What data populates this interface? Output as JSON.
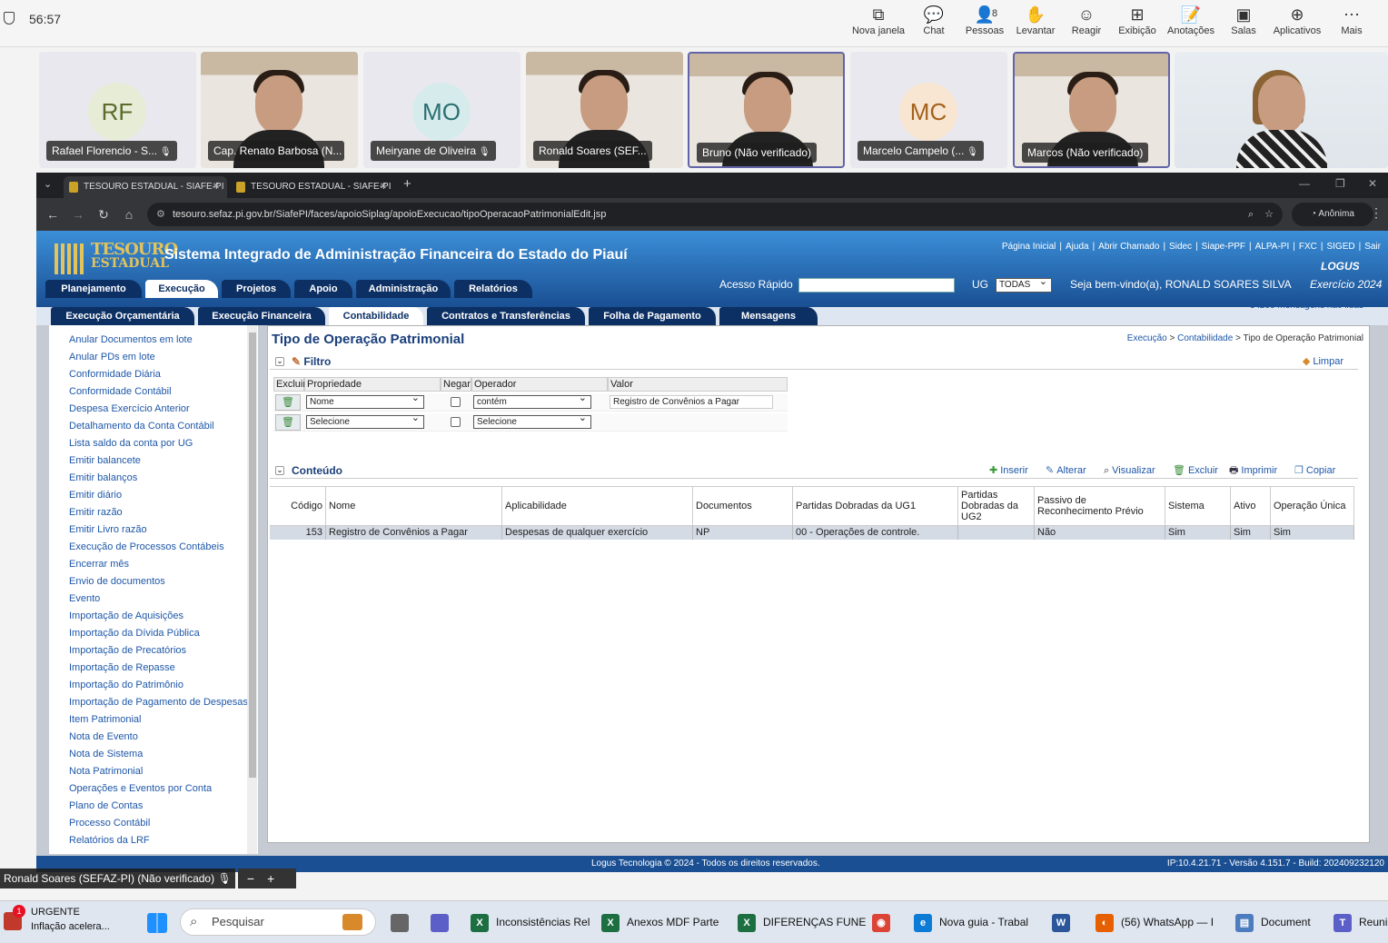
{
  "teams": {
    "time": "56:57",
    "buttons": [
      {
        "label": "Nova janela",
        "icon": "new-window-icon",
        "glyph": "⧉"
      },
      {
        "label": "Chat",
        "icon": "chat-icon",
        "glyph": "💬"
      },
      {
        "label": "Pessoas",
        "icon": "people-icon",
        "glyph": "👤",
        "badge": "8"
      },
      {
        "label": "Levantar",
        "icon": "raise-hand-icon",
        "glyph": "✋"
      },
      {
        "label": "Reagir",
        "icon": "react-icon",
        "glyph": "☺"
      },
      {
        "label": "Exibição",
        "icon": "view-icon",
        "glyph": "⊞"
      },
      {
        "label": "Anotações",
        "icon": "notes-icon",
        "glyph": "📝"
      },
      {
        "label": "Salas",
        "icon": "rooms-icon",
        "glyph": "▣"
      },
      {
        "label": "Aplicativos",
        "icon": "apps-icon",
        "glyph": "⊕"
      },
      {
        "label": "Mais",
        "icon": "more-icon",
        "glyph": "⋯"
      }
    ],
    "participants": [
      {
        "name": "Rafael Florencio - S...",
        "initials": "RF",
        "avatar_bg": "#e6ecd6",
        "avatar_fg": "#5a6b2c",
        "video": false
      },
      {
        "name": "Cap. Renato Barbosa (N...",
        "initials": "",
        "video": true
      },
      {
        "name": "Meiryane de Oliveira",
        "initials": "MO",
        "avatar_bg": "#d6ecec",
        "avatar_fg": "#2b6f72",
        "video": false
      },
      {
        "name": "Ronald Soares (SEF...",
        "initials": "",
        "video": true
      },
      {
        "name": "Bruno (Não verificado)",
        "initials": "",
        "video": true,
        "selected": true
      },
      {
        "name": "Marcelo Campelo (...",
        "initials": "MC",
        "avatar_bg": "#f8e6d2",
        "avatar_fg": "#a4621c",
        "video": false
      },
      {
        "name": "Marcos (Não verificado)",
        "initials": "",
        "video": true,
        "selected": true
      },
      {
        "name": "",
        "initials": "",
        "video": true
      }
    ],
    "self_tag": "Ronald Soares (SEFAZ-PI) (Não verificado)"
  },
  "browser": {
    "tabs": [
      "TESOURO ESTADUAL - SIAFE-PI",
      "TESOURO ESTADUAL - SIAFE-PI"
    ],
    "url": "tesouro.sefaz.pi.gov.br/SiafePI/faces/apoioSiplag/apoioExecucao/tipoOperacaoPatrimonialEdit.jsp",
    "incognito": "Anônima"
  },
  "siafe": {
    "logo_line1": "TESOURO",
    "logo_line2": "ESTADUAL",
    "title": "Sistema Integrado de Administração Financeira do Estado do Piauí",
    "top_links": [
      "Página Inicial",
      "Ajuda",
      "Abrir Chamado",
      "Sidec",
      "Siape-PPF",
      "ALPA-PI",
      "FXC",
      "SIGED",
      "Sair"
    ],
    "logus": "LOGUS",
    "main_tabs": [
      "Planejamento",
      "Execução",
      "Projetos",
      "Apoio",
      "Administração",
      "Relatórios"
    ],
    "acesso_rapido": "Acesso Rápido",
    "ug_label": "UG",
    "ug_value": "TODAS",
    "welcome": "Seja bem-vindo(a), RONALD SOARES SILVA",
    "exercicio": "Exercício 2024",
    "sub_tabs": [
      "Execução Orçamentária",
      "Execução Financeira",
      "Contabilidade",
      "Contratos e Transferências",
      "Folha de Pagamento",
      "Mensagens"
    ],
    "messages": "34295 mensagens não lidas",
    "sidebar": [
      "Anular Documentos em lote",
      "Anular PDs em lote",
      "Conformidade Diária",
      "Conformidade Contábil",
      "Despesa Exercício Anterior",
      "Detalhamento da Conta Contábil",
      "Lista saldo da conta por UG",
      "Emitir balancete",
      "Emitir balanços",
      "Emitir diário",
      "Emitir razão",
      "Emitir Livro razão",
      "Execução de Processos Contábeis",
      "Encerrar mês",
      "Envio de documentos",
      "Evento",
      "Importação de Aquisições",
      "Importação da Dívida Pública",
      "Importação de Precatórios",
      "Importação de Repasse",
      "Importação do Patrimônio",
      "Importação de Pagamento de Despesas",
      "Item Patrimonial",
      "Nota de Evento",
      "Nota de Sistema",
      "Nota Patrimonial",
      "Operações e Eventos por Conta",
      "Plano de Contas",
      "Processo Contábil",
      "Relatórios da LRF"
    ],
    "page_title": "Tipo de Operação Patrimonial",
    "breadcrumb": [
      "Execução",
      "Contabilidade",
      "Tipo de Operação Patrimonial"
    ],
    "filter": {
      "title": "Filtro",
      "clear": "Limpar",
      "headers": [
        "Excluir",
        "Propriedade",
        "Negar",
        "Operador",
        "Valor"
      ],
      "rows": [
        {
          "property": "Nome",
          "operator": "contém",
          "value": "Registro de Convênios a Pagar"
        },
        {
          "property": "Selecione",
          "operator": "Selecione",
          "value": ""
        }
      ]
    },
    "content": {
      "title": "Conteúdo",
      "tools": [
        "Inserir",
        "Alterar",
        "Visualizar",
        "Excluir",
        "Imprimir",
        "Copiar"
      ],
      "headers": [
        "Código",
        "Nome",
        "Aplicabilidade",
        "Documentos",
        "Partidas Dobradas da UG1",
        "Partidas Dobradas da UG2",
        "Passivo de Reconhecimento Prévio",
        "Sistema",
        "Ativo",
        "Operação Única"
      ],
      "row": [
        "153",
        "Registro de Convênios a Pagar",
        "Despesas de qualquer exercício",
        "NP",
        "00 - Operações de controle.",
        "",
        "Não",
        "Sim",
        "Sim",
        "Sim"
      ]
    },
    "footer": "Logus Tecnologia © 2024 - Todos os direitos reservados.",
    "footer_right": "IP:10.4.21.71 - Versão 4.151.7 - Build: 202409232120"
  },
  "taskbar": {
    "news_title": "URGENTE",
    "news_sub": "Inflação acelera...",
    "news_badge": "1",
    "search": "Pesquisar",
    "apps": [
      {
        "label": "Inconsistências Rel",
        "color": "#1d6f42",
        "glyph": "X"
      },
      {
        "label": "Anexos MDF Parte",
        "color": "#1d6f42",
        "glyph": "X"
      },
      {
        "label": "DIFERENÇAS FUNE",
        "color": "#1d6f42",
        "glyph": "X"
      },
      {
        "label": "",
        "color": "#db4437",
        "glyph": "◉"
      },
      {
        "label": "Nova guia - Trabal",
        "color": "#0c7bd6",
        "glyph": "e"
      },
      {
        "label": "",
        "color": "#2b579a",
        "glyph": "W"
      },
      {
        "label": "(56) WhatsApp — I",
        "color": "#e66000",
        "glyph": "◐"
      },
      {
        "label": "Document",
        "color": "#4d7cbf",
        "glyph": "▤"
      },
      {
        "label": "Reuni",
        "color": "#5b5fc7",
        "glyph": "T"
      }
    ]
  }
}
